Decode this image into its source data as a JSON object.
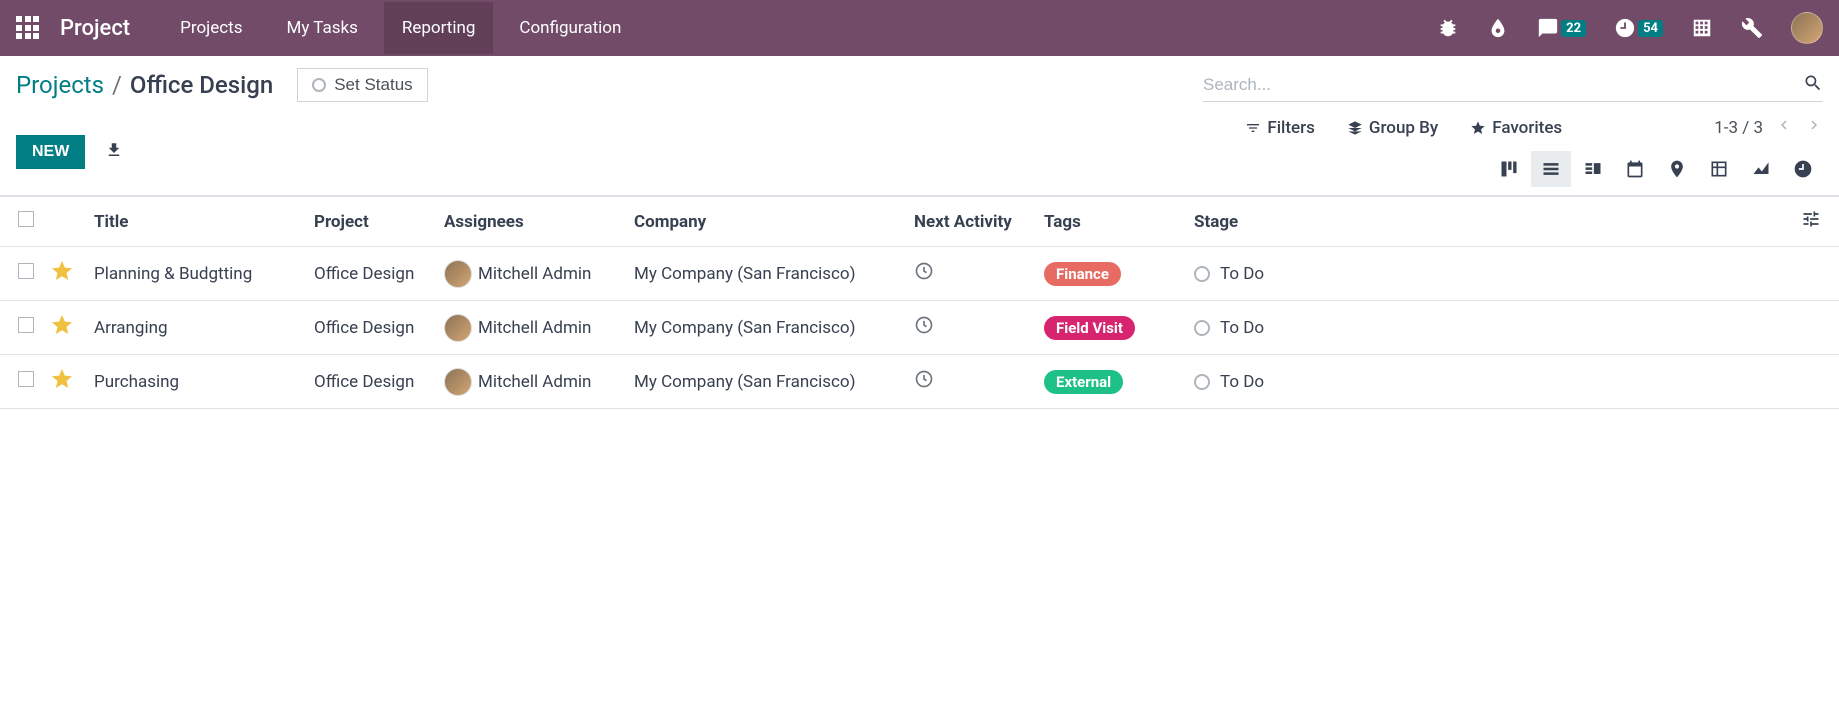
{
  "navbar": {
    "brand": "Project",
    "items": [
      "Projects",
      "My Tasks",
      "Reporting",
      "Configuration"
    ],
    "active_index": 2,
    "messages_count": "22",
    "activities_count": "54"
  },
  "breadcrumb": {
    "link": "Projects",
    "current": "Office Design"
  },
  "set_status_label": "Set Status",
  "search_placeholder": "Search...",
  "new_button": "NEW",
  "search_options": {
    "filters": "Filters",
    "group_by": "Group By",
    "favorites": "Favorites"
  },
  "pager": "1-3 / 3",
  "columns": {
    "title": "Title",
    "project": "Project",
    "assignees": "Assignees",
    "company": "Company",
    "next_activity": "Next Activity",
    "tags": "Tags",
    "stage": "Stage"
  },
  "rows": [
    {
      "title": "Planning & Budgtting",
      "project": "Office Design",
      "assignee": "Mitchell Admin",
      "company": "My Company (San Francisco)",
      "tag": "Finance",
      "tag_color": "#e76b62",
      "stage": "To Do"
    },
    {
      "title": "Arranging",
      "project": "Office Design",
      "assignee": "Mitchell Admin",
      "company": "My Company (San Francisco)",
      "tag": "Field Visit",
      "tag_color": "#d6246e",
      "stage": "To Do"
    },
    {
      "title": "Purchasing",
      "project": "Office Design",
      "assignee": "Mitchell Admin",
      "company": "My Company (San Francisco)",
      "tag": "External",
      "tag_color": "#1ec185",
      "stage": "To Do"
    }
  ]
}
